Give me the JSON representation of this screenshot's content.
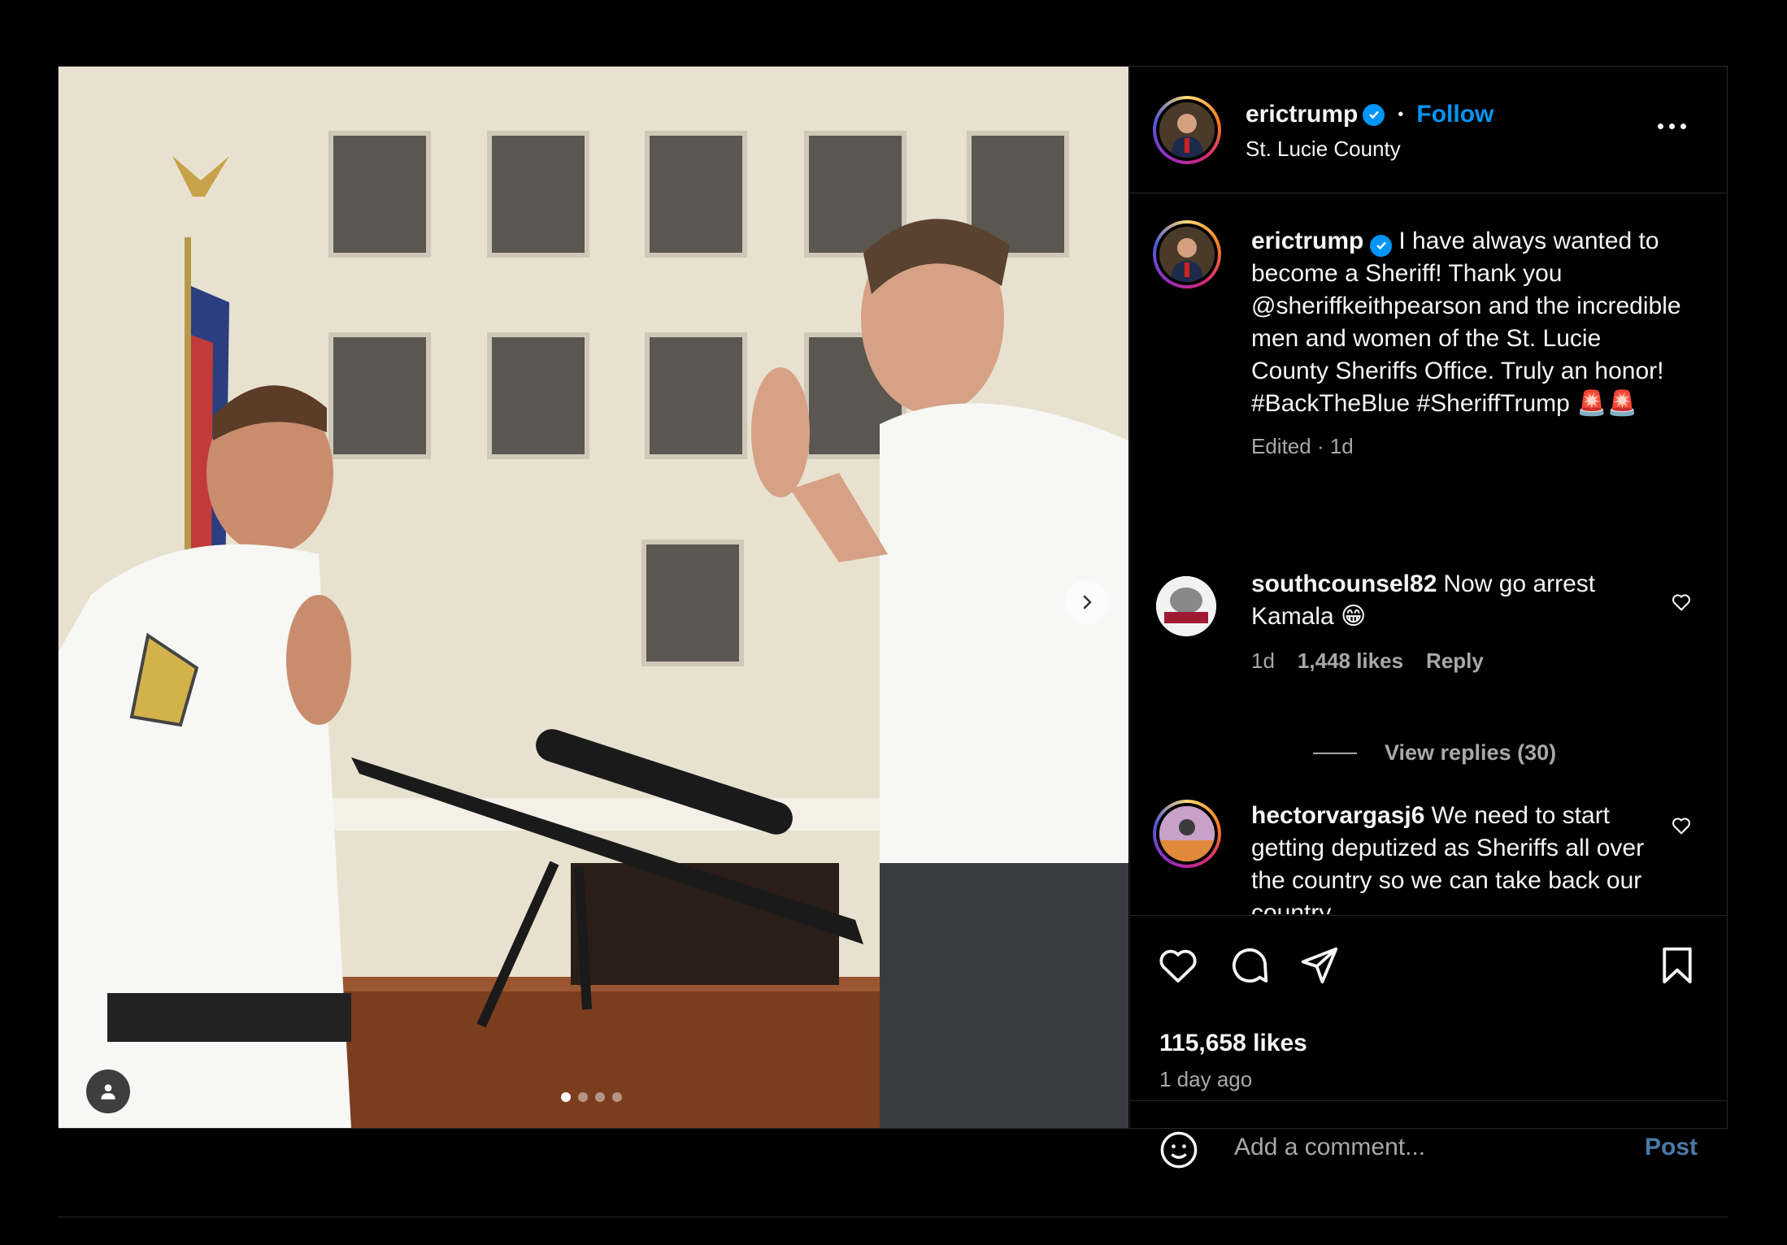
{
  "post": {
    "username": "erictrump",
    "follow_label": "Follow",
    "separator": "•",
    "location": "St. Lucie County",
    "caption": {
      "username": "erictrump",
      "text": "I have always wanted to become a Sheriff! Thank you @sheriffkeithpearson and the incredible men and women of the St. Lucie County Sheriffs Office. Truly an honor! #BackTheBlue #SheriffTrump 🚨🚨",
      "meta": "Edited · 1d"
    },
    "carousel": {
      "slide_count": 4,
      "active_index": 0
    },
    "comments": [
      {
        "username": "southcounsel82",
        "text": "Now go arrest Kamala 😁",
        "time": "1d",
        "likes": "1,448 likes",
        "reply_label": "Reply",
        "view_replies": "View replies (30)"
      },
      {
        "username": "hectorvargasj6",
        "text": "We need to start getting deputized as Sheriffs all over the country so we can take back our country"
      }
    ],
    "likes": "115,658 likes",
    "time_ago": "1 day ago",
    "add_comment_placeholder": "Add a comment...",
    "post_label": "Post"
  },
  "colors": {
    "accent": "#0095f6",
    "background": "#000000",
    "muted_text": "#a8a8a8",
    "divider": "#262626"
  },
  "icons": [
    "more-options-icon",
    "verified-badge-icon",
    "heart-icon",
    "comment-icon",
    "share-icon",
    "bookmark-icon",
    "emoji-icon",
    "chevron-right-icon",
    "person-tag-icon"
  ]
}
